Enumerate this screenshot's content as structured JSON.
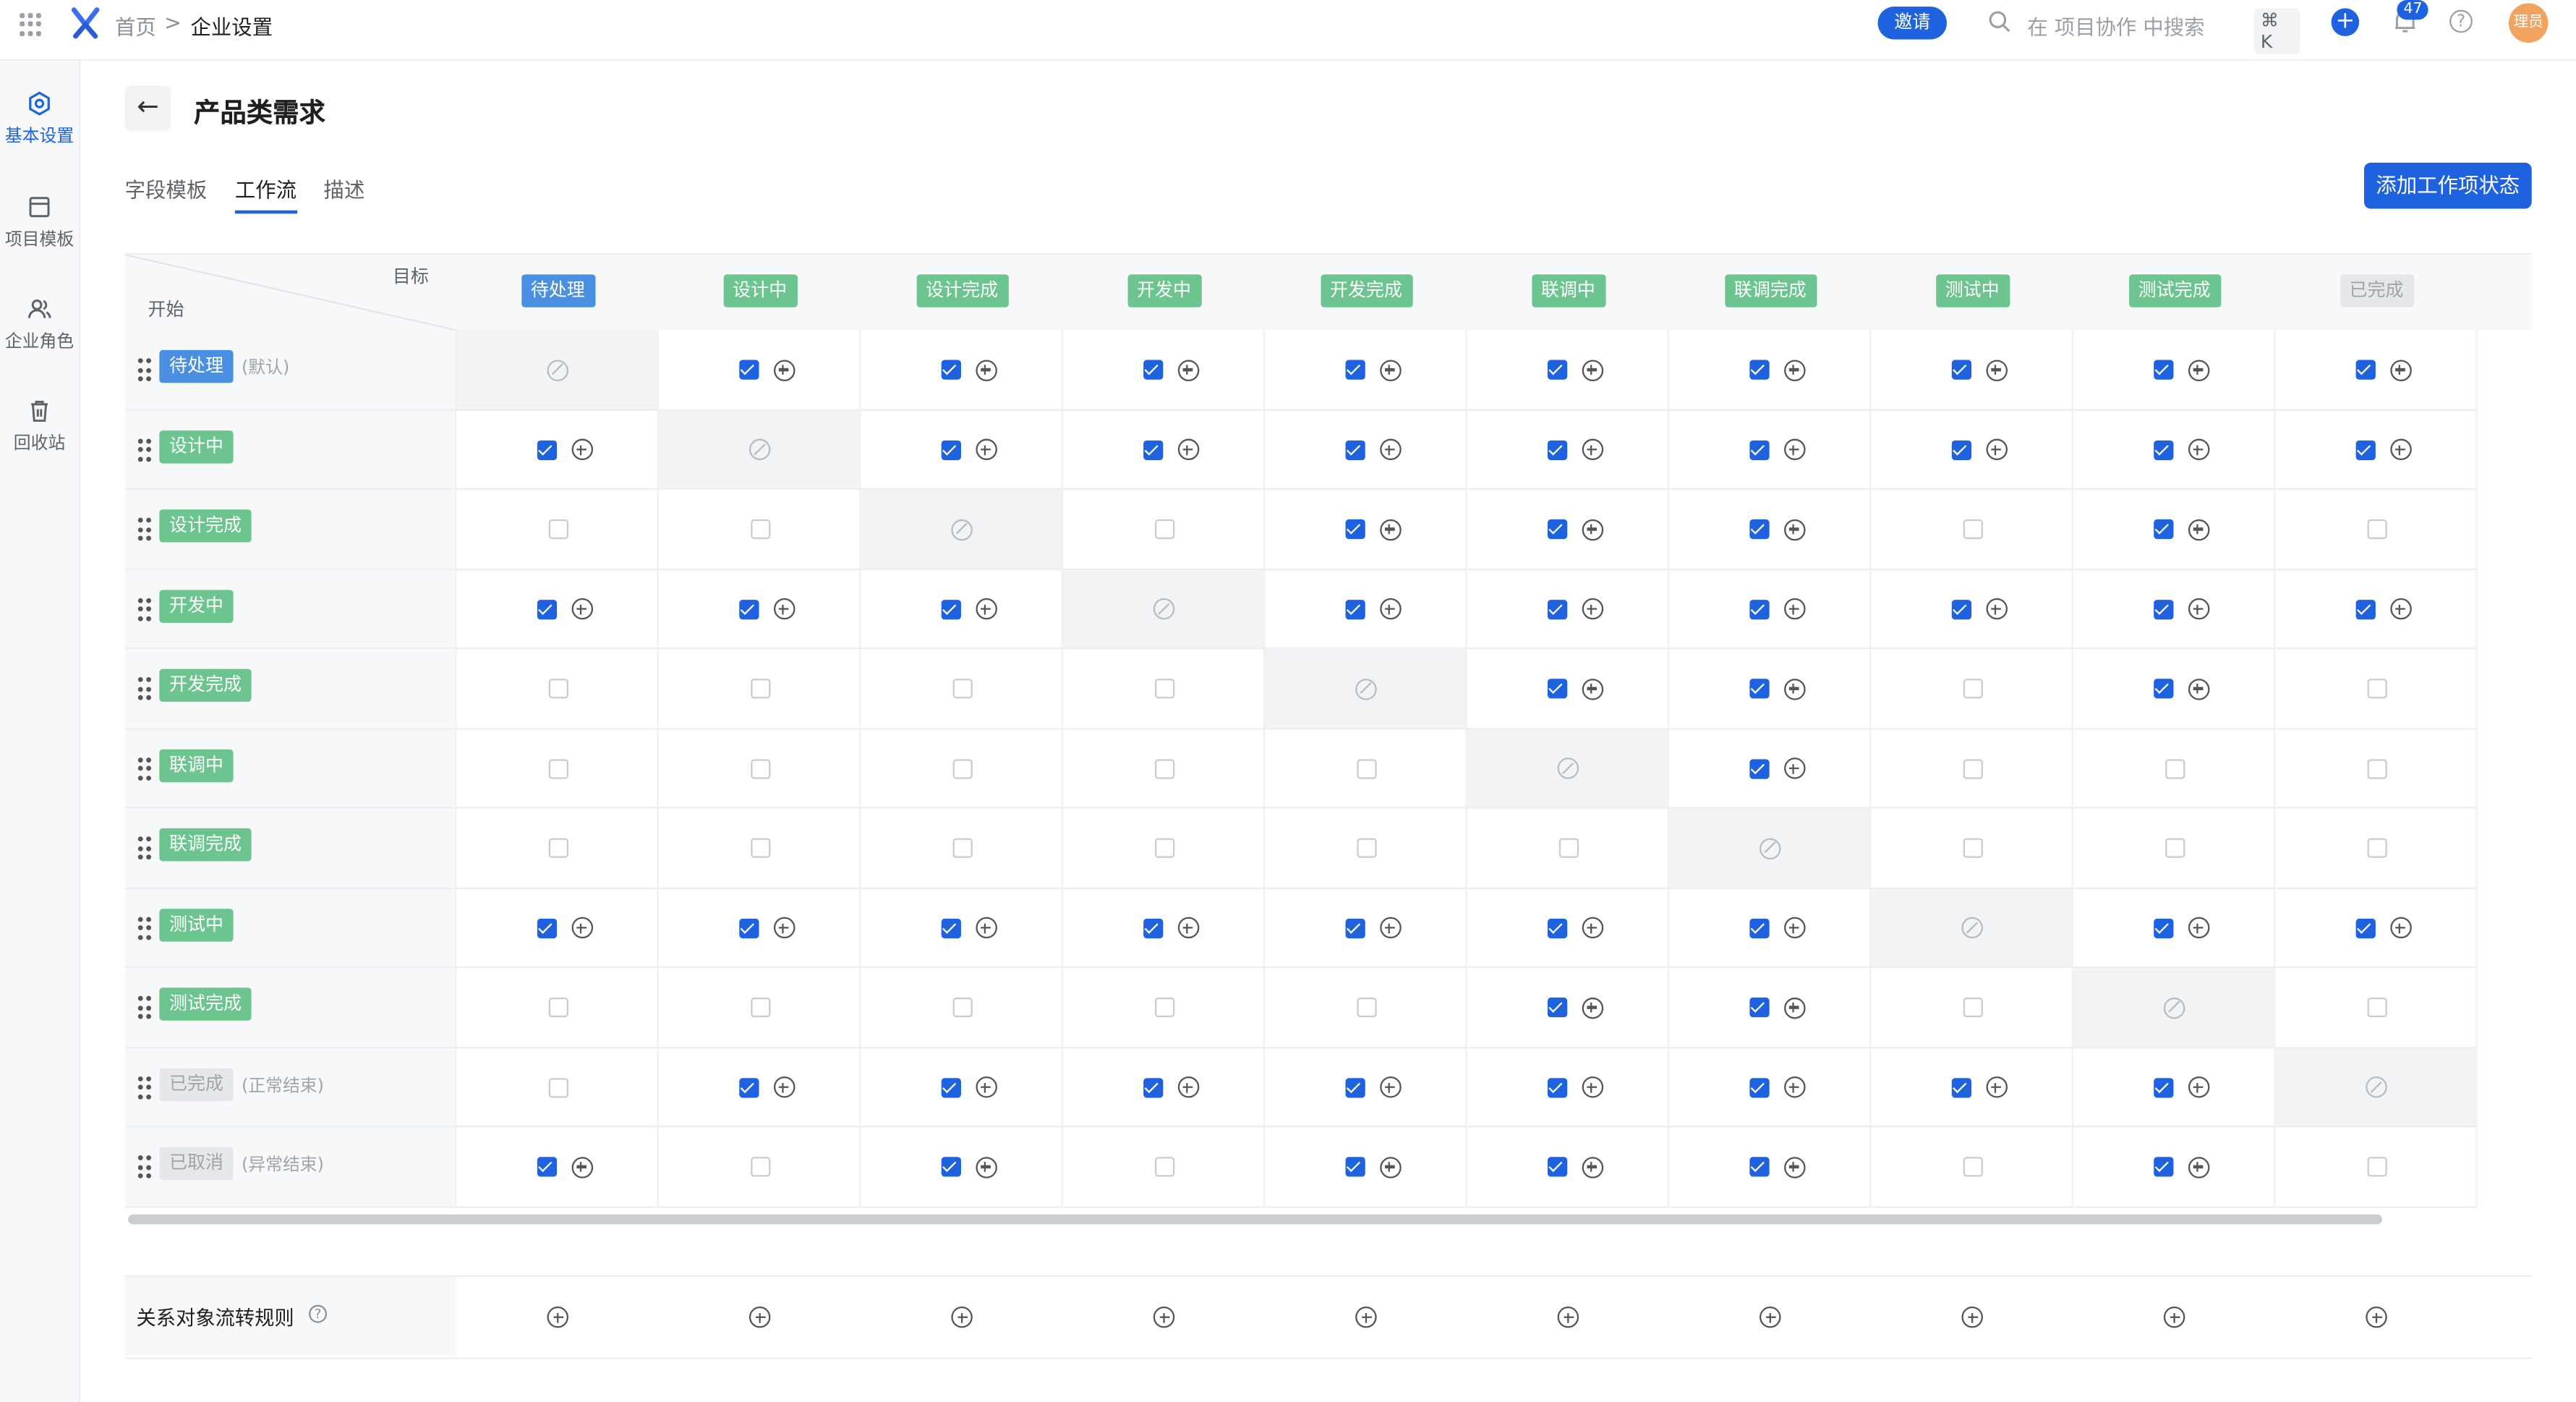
{
  "topbar": {
    "breadcrumb_home": "首页",
    "breadcrumb_sep": ">",
    "breadcrumb_current": "企业设置",
    "invite_label": "邀请",
    "search_placeholder": "在 项目协作 中搜索",
    "search_shortcut": "⌘ K",
    "plus_label": "+",
    "notification_count": "47",
    "help_label": "?",
    "avatar_text": "理员"
  },
  "sidebar": {
    "items": [
      {
        "label": "基本设置",
        "icon": "settings-hex-icon",
        "active": true
      },
      {
        "label": "项目模板",
        "icon": "template-icon",
        "active": false
      },
      {
        "label": "企业角色",
        "icon": "users-icon",
        "active": false
      },
      {
        "label": "回收站",
        "icon": "trash-icon",
        "active": false
      }
    ]
  },
  "page": {
    "back_label": "←",
    "title": "产品类需求",
    "tabs": [
      "字段模板",
      "工作流",
      "描述"
    ],
    "active_tab": 1,
    "add_status_label": "添加工作项状态"
  },
  "colors": {
    "accent": "#1f62e0",
    "tag_blue": "#4a90e2",
    "tag_green": "#6cc58f",
    "tag_gray": "#e6e7ea"
  },
  "workflow": {
    "corner_target": "目标",
    "corner_start": "开始",
    "states": [
      {
        "name": "待处理",
        "color": "blue",
        "note": "(默认)"
      },
      {
        "name": "设计中",
        "color": "green",
        "note": ""
      },
      {
        "name": "设计完成",
        "color": "green",
        "note": ""
      },
      {
        "name": "开发中",
        "color": "green",
        "note": ""
      },
      {
        "name": "开发完成",
        "color": "green",
        "note": ""
      },
      {
        "name": "联调中",
        "color": "green",
        "note": ""
      },
      {
        "name": "联调完成",
        "color": "green",
        "note": ""
      },
      {
        "name": "测试中",
        "color": "green",
        "note": ""
      },
      {
        "name": "测试完成",
        "color": "green",
        "note": ""
      },
      {
        "name": "已完成",
        "color": "gray",
        "note": "(正常结束)"
      },
      {
        "name": "已取消",
        "color": "gray",
        "note": "(异常结束)"
      }
    ],
    "target_columns": [
      "待处理",
      "设计中",
      "设计完成",
      "开发中",
      "开发完成",
      "联调中",
      "联调完成",
      "测试中",
      "测试完成",
      "已完成"
    ],
    "matrix": [
      [
        "X",
        1,
        1,
        1,
        1,
        1,
        1,
        1,
        1,
        1
      ],
      [
        1,
        "X",
        1,
        1,
        1,
        1,
        1,
        1,
        1,
        1
      ],
      [
        0,
        0,
        "X",
        0,
        1,
        1,
        1,
        0,
        1,
        0
      ],
      [
        1,
        1,
        1,
        "X",
        1,
        1,
        1,
        1,
        1,
        1
      ],
      [
        0,
        0,
        0,
        0,
        "X",
        1,
        1,
        0,
        1,
        0
      ],
      [
        0,
        0,
        0,
        0,
        0,
        "X",
        1,
        0,
        0,
        0
      ],
      [
        0,
        0,
        0,
        0,
        0,
        0,
        "X",
        0,
        0,
        0
      ],
      [
        1,
        1,
        1,
        1,
        1,
        1,
        1,
        "X",
        1,
        1
      ],
      [
        0,
        0,
        0,
        0,
        0,
        1,
        1,
        0,
        "X",
        0
      ],
      [
        0,
        1,
        1,
        1,
        1,
        1,
        1,
        1,
        1,
        "X"
      ],
      [
        1,
        0,
        1,
        0,
        1,
        1,
        1,
        0,
        1,
        0
      ]
    ],
    "relation_rule_label": "关系对象流转规则"
  }
}
